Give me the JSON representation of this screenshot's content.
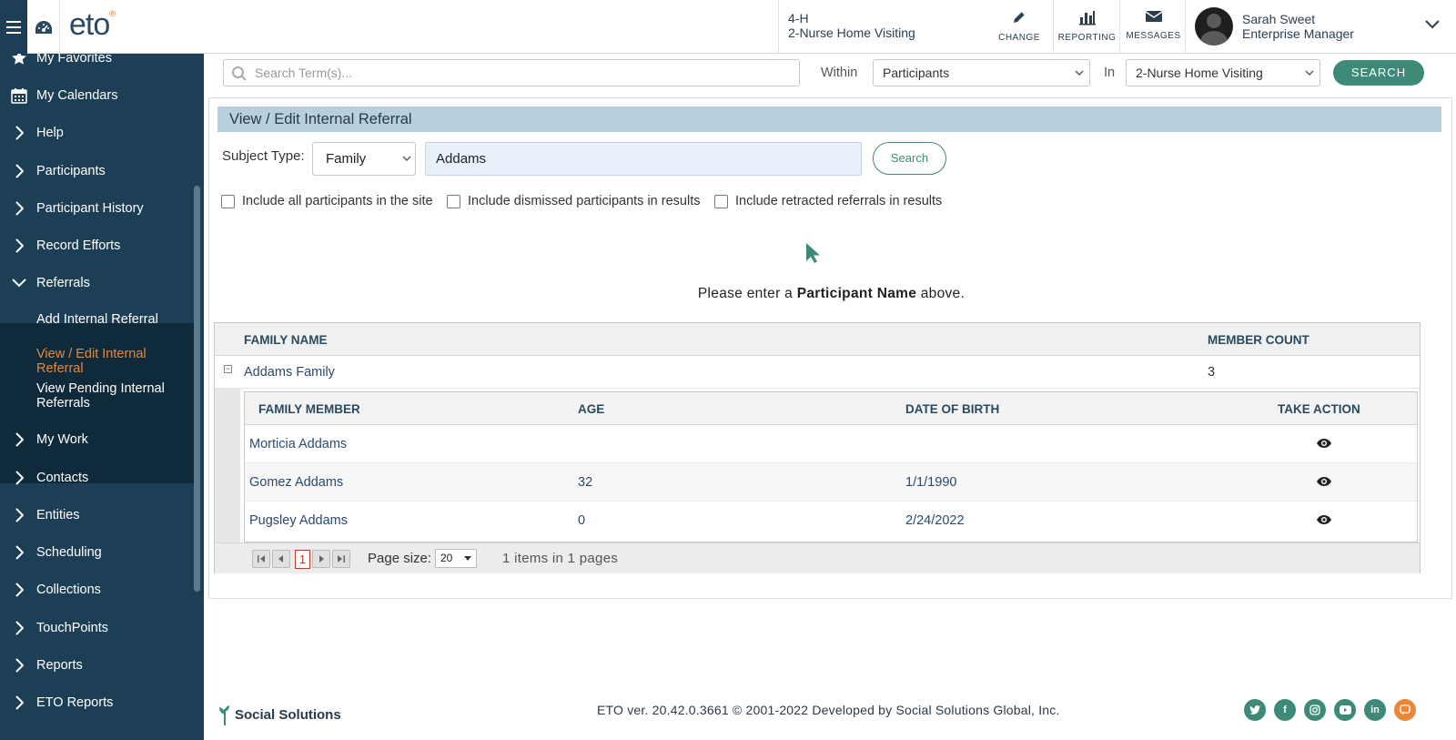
{
  "header": {
    "logo": "eto",
    "site_program": "4-H",
    "site_name": "2-Nurse Home Visiting",
    "change_label": "CHANGE",
    "reporting_label": "REPORTING",
    "messages_label": "MESSAGES",
    "user_name": "Sarah Sweet",
    "user_role": "Enterprise Manager"
  },
  "sidebar": {
    "items": [
      {
        "label": "My Favorites",
        "icon": "star-icon"
      },
      {
        "label": "My Calendars",
        "icon": "calendar-icon"
      },
      {
        "label": "Help",
        "icon": "chevron-right-icon"
      },
      {
        "label": "Participants",
        "icon": "chevron-right-icon"
      },
      {
        "label": "Participant History",
        "icon": "chevron-right-icon"
      },
      {
        "label": "Record Efforts",
        "icon": "chevron-right-icon"
      },
      {
        "label": "Referrals",
        "icon": "chevron-down-icon"
      },
      {
        "label": "My Work",
        "icon": "chevron-right-icon"
      },
      {
        "label": "Contacts",
        "icon": "chevron-right-icon"
      },
      {
        "label": "Entities",
        "icon": "chevron-right-icon"
      },
      {
        "label": "Scheduling",
        "icon": "chevron-right-icon"
      },
      {
        "label": "Collections",
        "icon": "chevron-right-icon"
      },
      {
        "label": "TouchPoints",
        "icon": "chevron-right-icon"
      },
      {
        "label": "Reports",
        "icon": "chevron-right-icon"
      },
      {
        "label": "ETO Reports",
        "icon": "chevron-right-icon"
      }
    ],
    "referrals_sub": [
      {
        "label": "Add Internal Referral"
      },
      {
        "label": "View / Edit Internal Referral"
      },
      {
        "label": "View Pending Internal Referrals"
      }
    ]
  },
  "search": {
    "placeholder": "Search Term(s)...",
    "within_label": "Within",
    "within_value": "Participants",
    "in_label": "In",
    "in_value": "2-Nurse Home Visiting",
    "button_label": "SEARCH"
  },
  "main": {
    "title": "View / Edit Internal Referral",
    "subject_type_label": "Subject Type:",
    "subject_type_value": "Family",
    "subject_input_value": "Addams",
    "search_button_label": "Search",
    "checkboxes": [
      {
        "label": "Include all participants in the site",
        "checked": false
      },
      {
        "label": "Include dismissed participants in results",
        "checked": false
      },
      {
        "label": "Include retracted referrals in results",
        "checked": false
      }
    ],
    "prompt_prefix": "Please enter a ",
    "prompt_bold": "Participant Name",
    "prompt_suffix": " above."
  },
  "grid": {
    "headers": {
      "family_name": "FAMILY NAME",
      "member_count": "MEMBER COUNT"
    },
    "family": {
      "name": "Addams Family",
      "count": "3"
    },
    "inner_headers": {
      "member": "FAMILY MEMBER",
      "age": "AGE",
      "dob": "DATE OF BIRTH",
      "action": "TAKE ACTION"
    },
    "members": [
      {
        "name": "Morticia Addams",
        "age": "",
        "dob": ""
      },
      {
        "name": "Gomez Addams",
        "age": "32",
        "dob": "1/1/1990"
      },
      {
        "name": "Pugsley Addams",
        "age": "0",
        "dob": "2/24/2022"
      }
    ],
    "pager": {
      "current_page": "1",
      "page_size_label": "Page size:",
      "page_size": "20",
      "info": "1 items in 1 pages"
    }
  },
  "footer": {
    "brand": "Social Solutions",
    "text": "ETO ver. 20.42.0.3661 © 2001-2022 Developed by Social Solutions Global, Inc."
  },
  "colors": {
    "sidebar": "#1d3f56",
    "accent": "#3e8a78",
    "active": "#e8883a",
    "title_bar": "#b6d0de"
  }
}
